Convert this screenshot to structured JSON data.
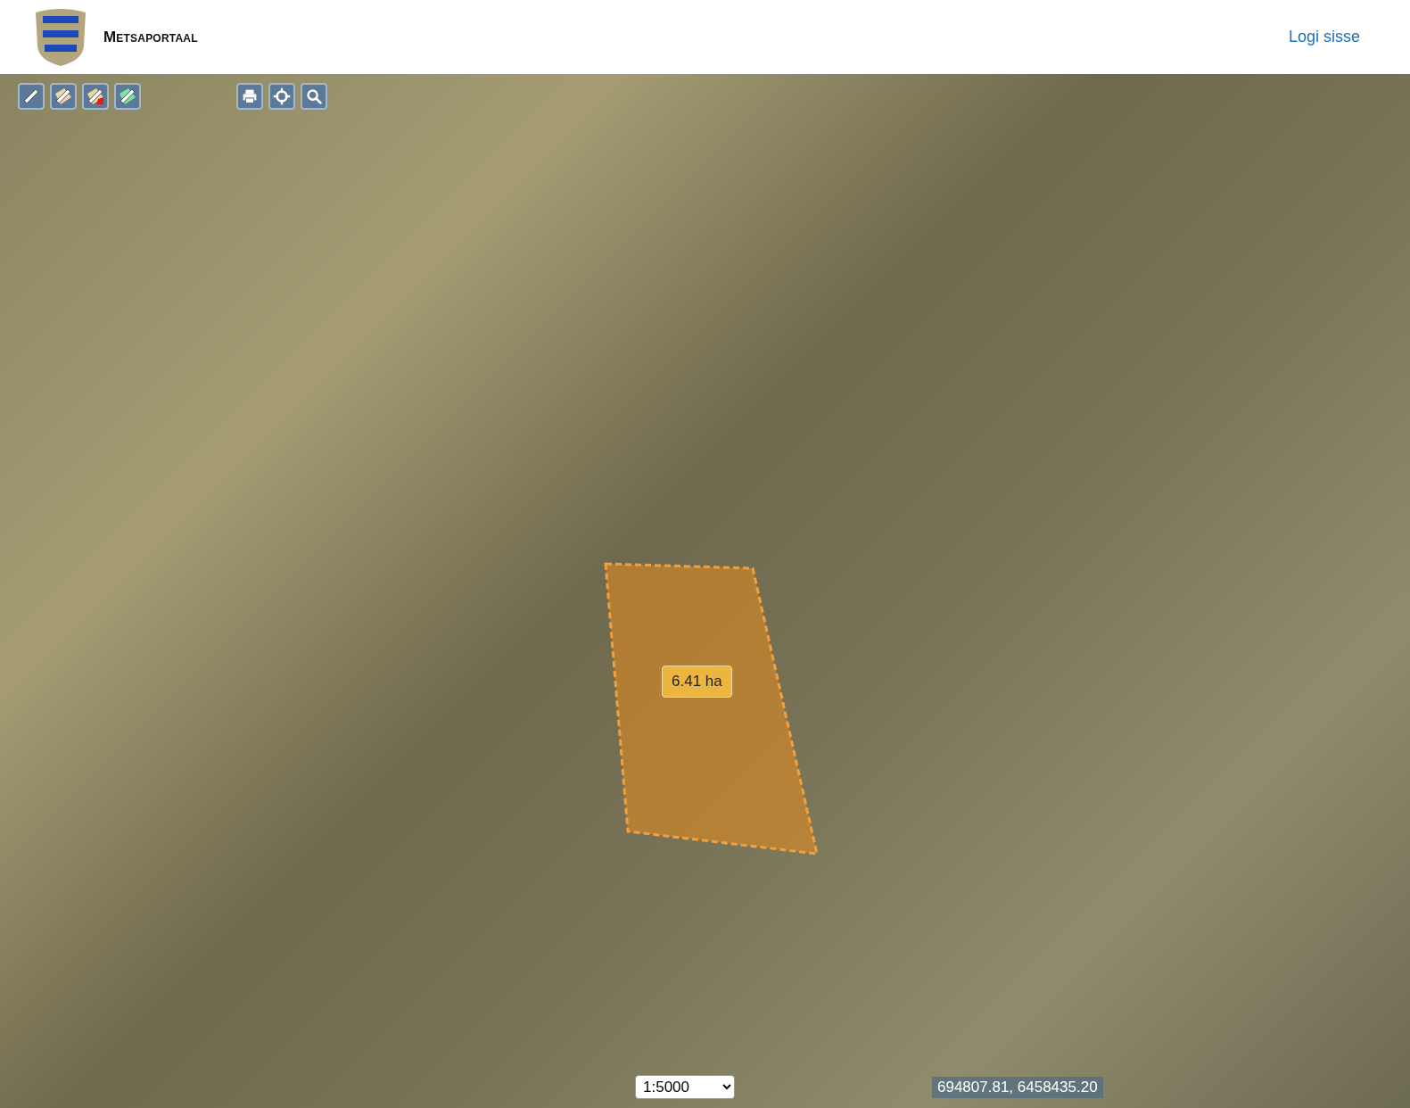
{
  "header": {
    "title": "Metsaportaal",
    "login_link": "Logi sisse"
  },
  "map_tools": [
    {
      "kind": "measure-line"
    },
    {
      "kind": "measure-area"
    },
    {
      "kind": "erase"
    },
    {
      "kind": "area-green"
    }
  ],
  "map_actions": [
    {
      "kind": "print"
    },
    {
      "kind": "locate"
    },
    {
      "kind": "search"
    }
  ],
  "measurement": {
    "label": "6.41 ha"
  },
  "scale_select": {
    "value": "1:5000"
  },
  "coordinates": "694807.81, 6458435.20"
}
